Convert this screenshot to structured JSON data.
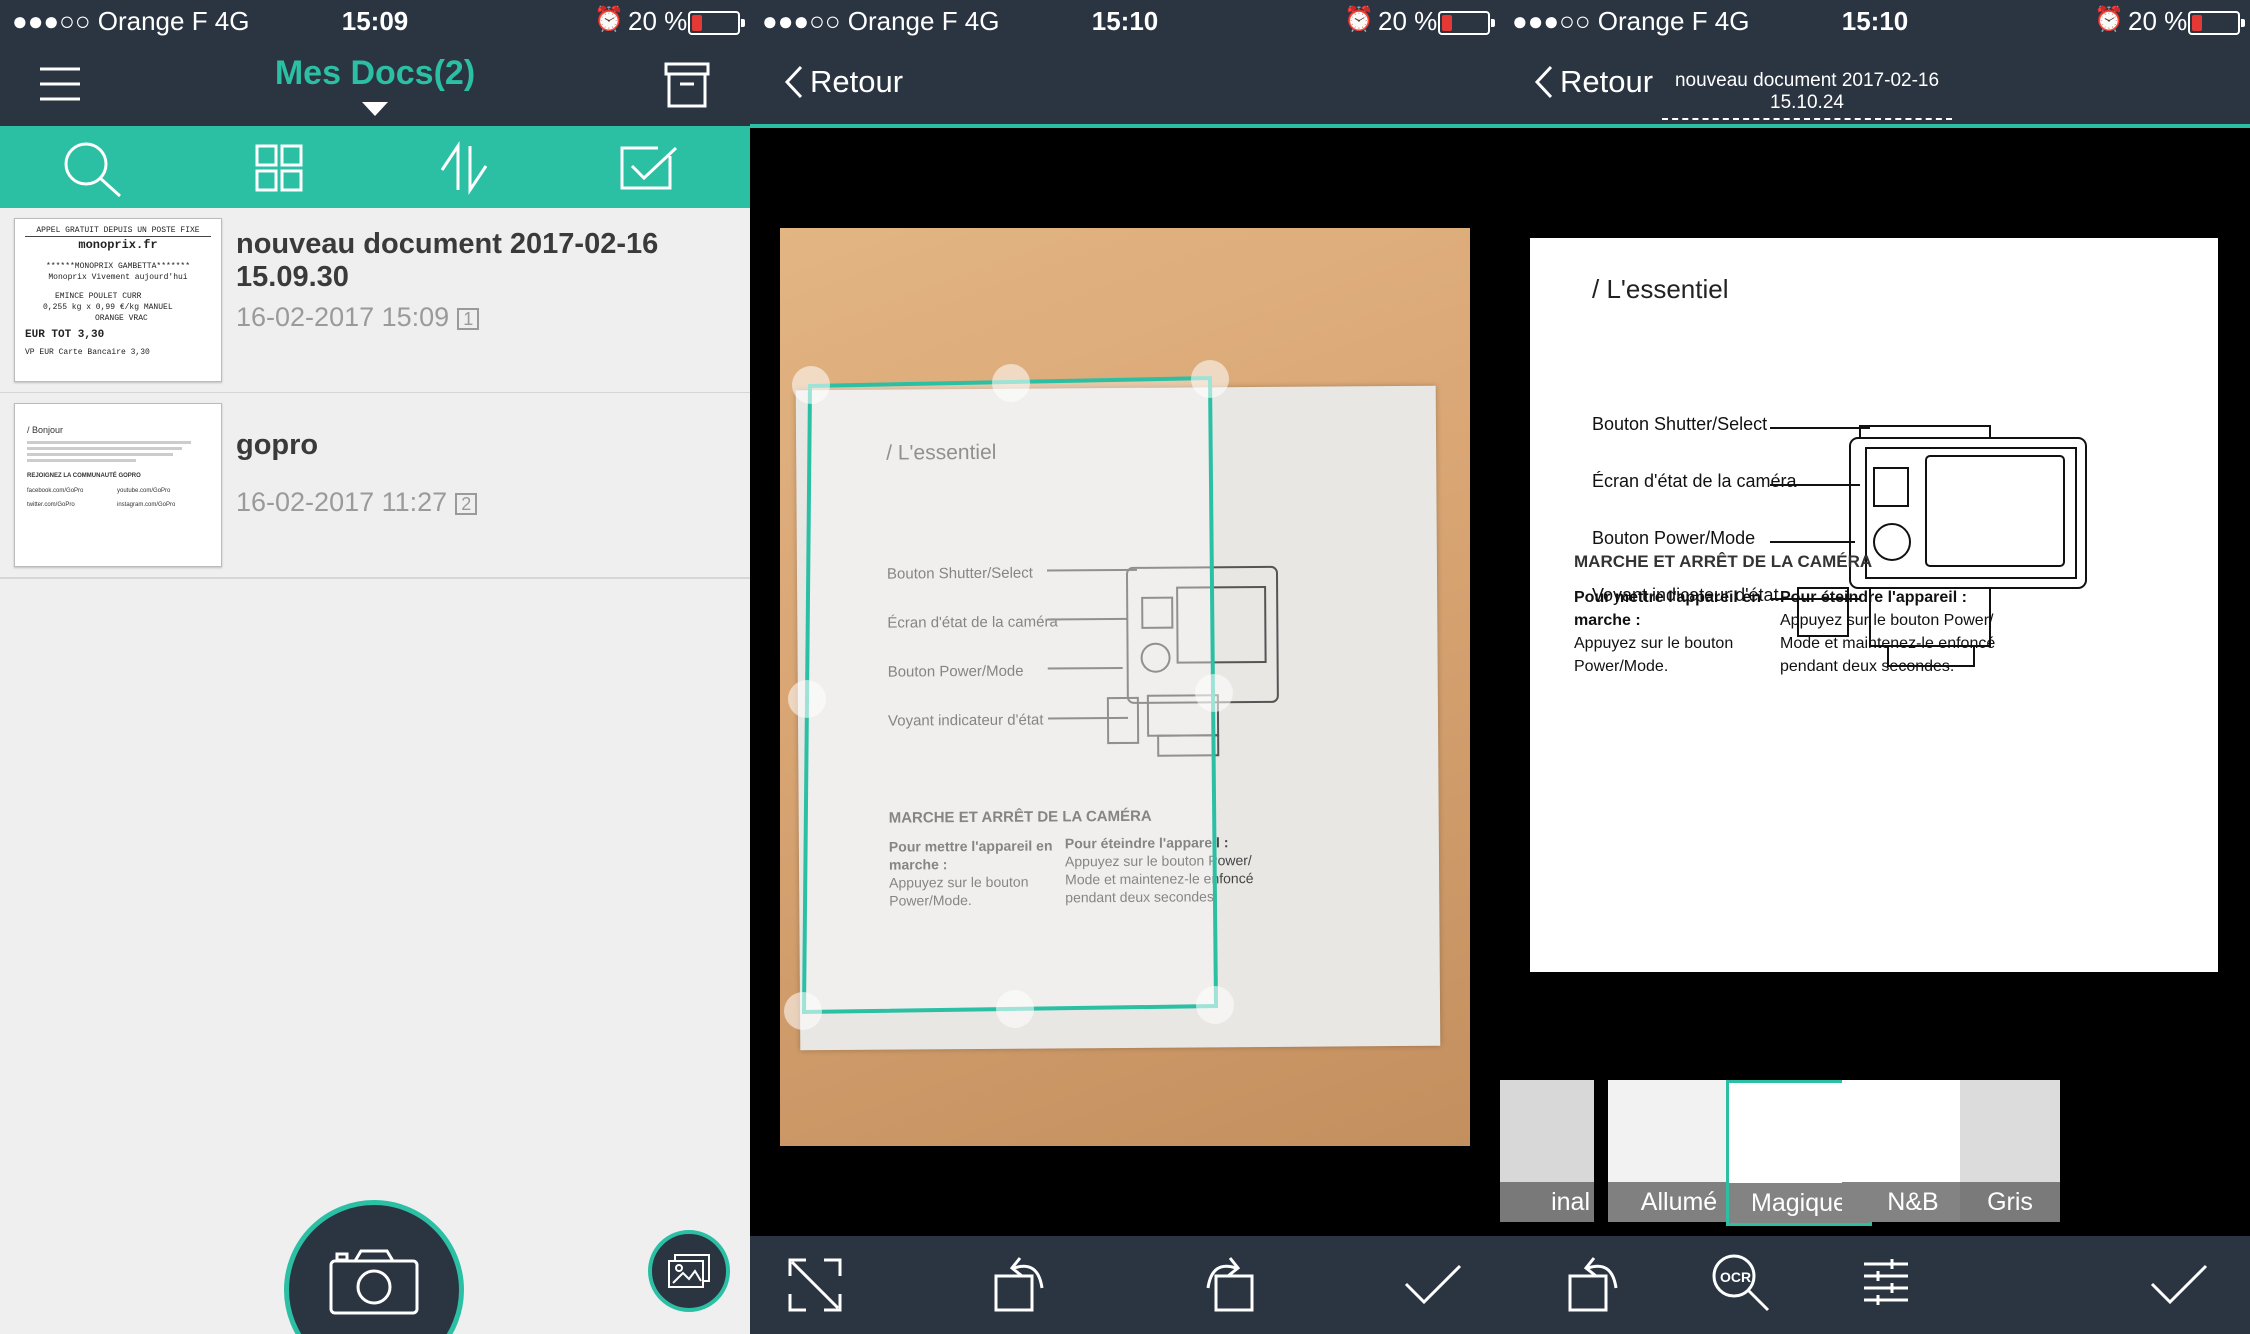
{
  "status": [
    {
      "carrier": "●●●○○ Orange F  4G",
      "time": "15:09",
      "battery": "20 %"
    },
    {
      "carrier": "●●●○○ Orange F  4G",
      "time": "15:10",
      "battery": "20 %"
    },
    {
      "carrier": "●●●○○ Orange F  4G",
      "time": "15:10",
      "battery": "20 %"
    }
  ],
  "screen1": {
    "title": "Mes Docs(2)",
    "docs": [
      {
        "title": "nouveau document 2017-02-16 15.09.30",
        "date": "16-02-2017 15:09",
        "pages": "1"
      },
      {
        "title": "gopro",
        "date": "16-02-2017 11:27",
        "pages": "2"
      }
    ],
    "receipt_lines": [
      "APPEL GRATUIT DEPUIS UN POSTE FIXE",
      "monoprix.fr",
      "******MONOPRIX GAMBETTA*******",
      "Monoprix Vivement aujourd'hui",
      "EMINCE POULET CURR",
      "0,255 kg x 0,99 €/kg MANUEL",
      "ORANGE VRAC",
      "EUR  TOT  3,30",
      "VP EUR Carte Bancaire 3,30"
    ],
    "gopro_lines": [
      "/ Bonjour",
      "REJOIGNEZ LA COMMUNAUTÉ GOPRO",
      "facebook.com/GoPro",
      "youtube.com/GoPro",
      "twitter.com/GoPro",
      "instagram.com/GoPro"
    ]
  },
  "screen2": {
    "back": "Retour"
  },
  "screen3": {
    "back": "Retour",
    "doc_name": "nouveau document 2017-02-16 15.10.24",
    "filters": [
      "inal",
      "Allumé",
      "Magique",
      "N&B",
      "Gris"
    ]
  },
  "page_content": {
    "heading": "/ L'essentiel",
    "labels": [
      "Bouton Shutter/Select",
      "Écran d'état de la caméra",
      "Bouton Power/Mode",
      "Voyant indicateur d'état"
    ],
    "section": "MARCHE ET ARRÊT DE LA CAMÉRA",
    "on_title": "Pour mettre l'appareil en marche :",
    "on_text": "Appuyez sur le bouton Power/Mode.",
    "off_title": "Pour éteindre l'appareil :",
    "off_text1": "Appuyez sur le bouton Power/",
    "off_text2": "Mode et maintenez-le enfoncé",
    "off_text3": "pendant deux secondes."
  },
  "colors": {
    "teal": "#2bbfa4",
    "navbar": "#2b3441",
    "list_bg": "#efefef"
  }
}
